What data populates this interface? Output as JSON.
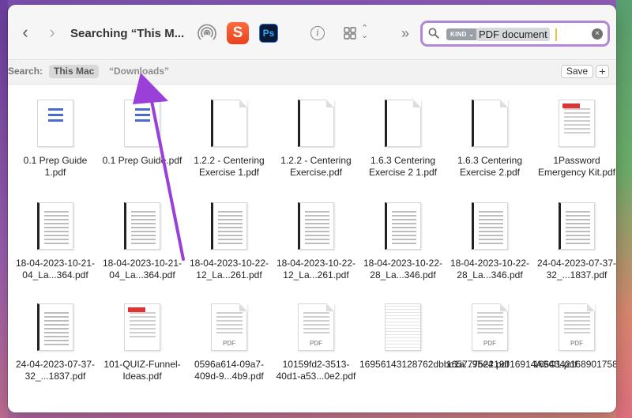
{
  "window": {
    "title": "Searching “This M...",
    "nav": {
      "back": "‹",
      "forward": "›"
    }
  },
  "toolbar": {
    "app_s_label": "S",
    "app_ps_label": "Ps",
    "info_label": "i",
    "more_label": "»"
  },
  "search": {
    "token": "KIND ⌄",
    "query": "PDF document",
    "clear": "×",
    "accent": "#b486d6"
  },
  "scope": {
    "label": "Search:",
    "this_mac": "This Mac",
    "downloads": "“Downloads”",
    "save": "Save",
    "add": "+"
  },
  "files": [
    {
      "name": "0.1 Prep Guide 1.pdf",
      "style": "blue"
    },
    {
      "name": "0.1 Prep Guide.pdf",
      "style": "blue"
    },
    {
      "name": "1.2.2 - Centering Exercise 1.pdf",
      "style": "dark"
    },
    {
      "name": "1.2.2 - Centering Exercise.pdf",
      "style": "dark"
    },
    {
      "name": "1.6.3 Centering Exercise 2 1.pdf",
      "style": "dark"
    },
    {
      "name": "1.6.3 Centering Exercise 2.pdf",
      "style": "dark"
    },
    {
      "name": "1Password Emergency Kit.pdf",
      "style": "red"
    },
    {
      "name": "18-04-2023-10-21-04_La...364.pdf",
      "style": "sheet"
    },
    {
      "name": "18-04-2023-10-21-04_La...364.pdf",
      "style": "sheet"
    },
    {
      "name": "18-04-2023-10-22-12_La...261.pdf",
      "style": "sheet"
    },
    {
      "name": "18-04-2023-10-22-12_La...261.pdf",
      "style": "sheet"
    },
    {
      "name": "18-04-2023-10-22-28_La...346.pdf",
      "style": "sheet"
    },
    {
      "name": "18-04-2023-10-22-28_La...346.pdf",
      "style": "sheet"
    },
    {
      "name": "24-04-2023-07-37-32_...1837.pdf",
      "style": "sheet"
    },
    {
      "name": "24-04-2023-07-37-32_...1837.pdf",
      "style": "sheet"
    },
    {
      "name": "101-QUIZ-Funnel-Ideas.pdf",
      "style": "red"
    },
    {
      "name": "0596a614-09a7-409d-9...4b9.pdf",
      "style": "pdf"
    },
    {
      "name": "10159fd2-3513-40d1-a53...0e2.pdf",
      "style": "pdf"
    },
    {
      "name": "16956143128762dbbc1a...9be4.pdf",
      "style": "grid"
    },
    {
      "name": "16577752219016914ASO1.pdf",
      "style": "pdf"
    },
    {
      "name": "16643421689017581ASO1.pdf",
      "style": "pdf"
    }
  ],
  "pdf_badge": "PDF"
}
